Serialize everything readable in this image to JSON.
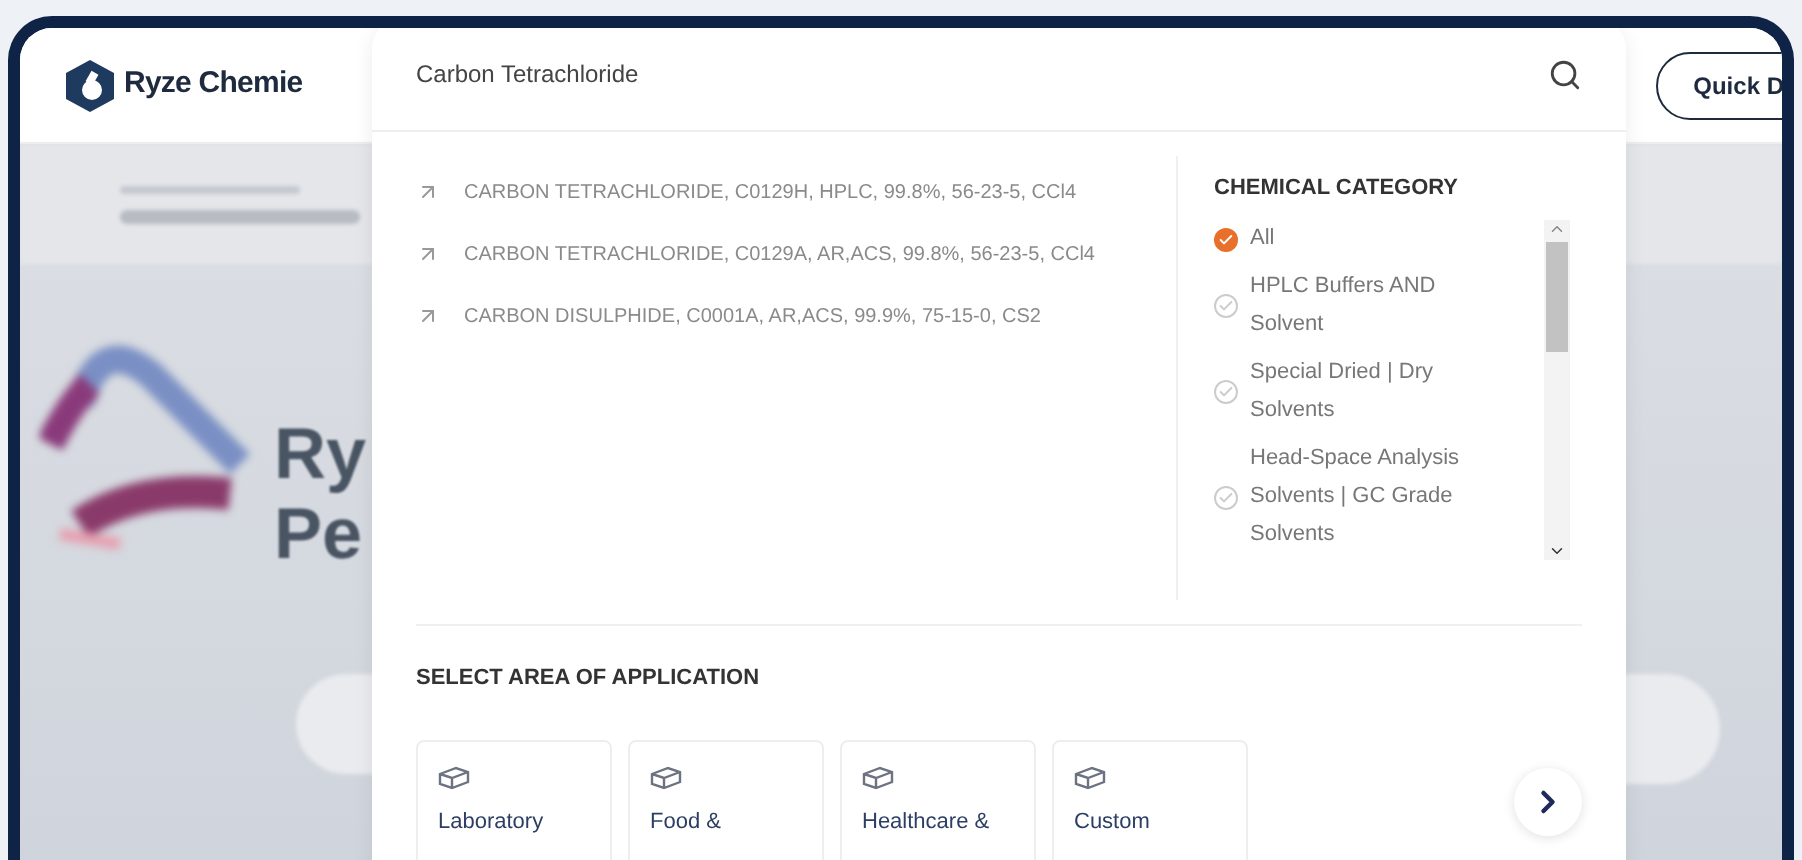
{
  "brand": {
    "name": "Ryze Chemie"
  },
  "search": {
    "value": "Carbon Tetrachloride"
  },
  "quick_button": {
    "label": "Quick D"
  },
  "hero": {
    "title_lines": [
      "Ry",
      "Pe"
    ]
  },
  "suggestions": [
    "CARBON TETRACHLORIDE, C0129H, HPLC, 99.8%, 56-23-5, CCl4",
    "CARBON TETRACHLORIDE, C0129A, AR,ACS, 99.8%, 56-23-5, CCl4",
    "CARBON DISULPHIDE, C0001A, AR,ACS, 99.9%, 75-15-0, CS2"
  ],
  "category": {
    "title": "CHEMICAL CATEGORY",
    "items": [
      {
        "label": "All",
        "selected": true
      },
      {
        "label": "HPLC Buffers AND Solvent",
        "selected": false
      },
      {
        "label": "Special Dried | Dry Solvents",
        "selected": false
      },
      {
        "label": "Head-Space Analysis Solvents | GC Grade Solvents",
        "selected": false
      }
    ]
  },
  "application": {
    "title": "SELECT AREA OF APPLICATION",
    "cards": [
      "Laboratory",
      "Food &",
      "Healthcare &",
      "Custom"
    ]
  }
}
